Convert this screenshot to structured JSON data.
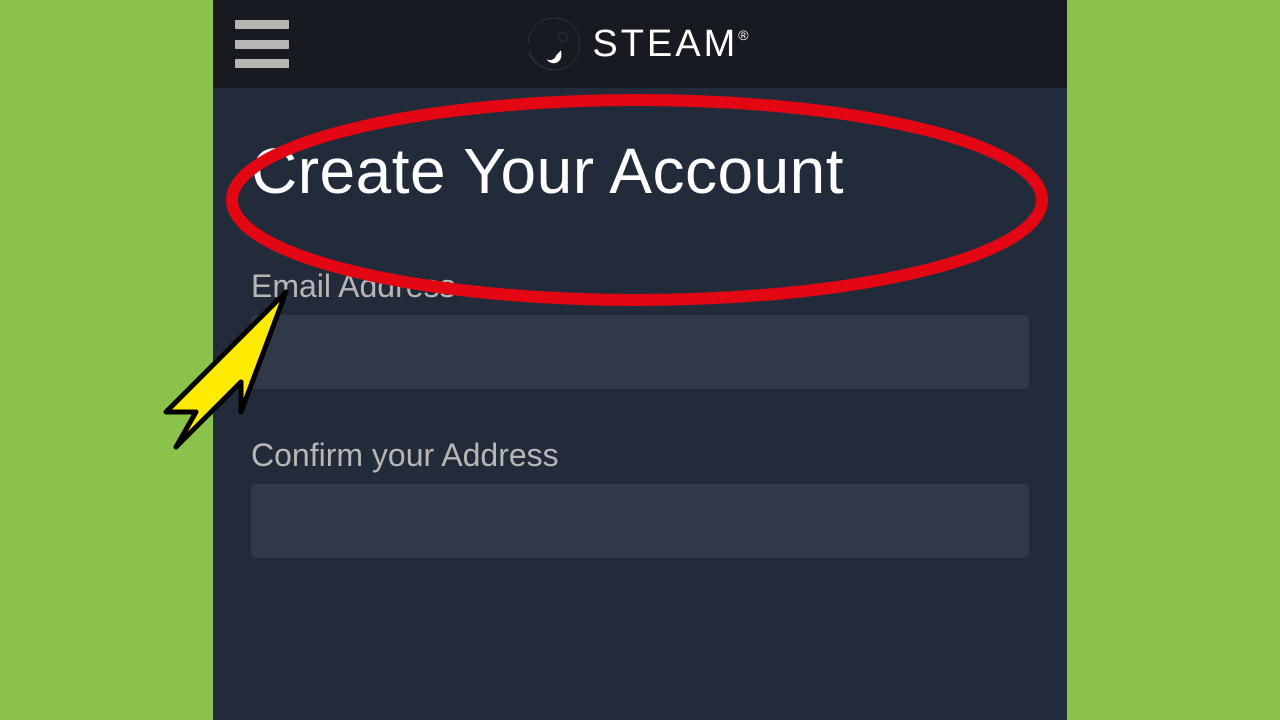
{
  "header": {
    "brand_text": "STEAM",
    "brand_trademark": "®"
  },
  "page": {
    "title": "Create Your Account"
  },
  "form": {
    "email_label": "Email Address",
    "email_value": "",
    "confirm_label": "Confirm your Address",
    "confirm_value": ""
  },
  "colors": {
    "background_outer": "#8BC34A",
    "header_bg": "#171a21",
    "content_bg": "#212b3a",
    "input_bg": "#30394a",
    "text_light": "#ffffff",
    "text_muted": "#b8b6b4",
    "annotation_red": "#E30613",
    "annotation_yellow": "#FFEB00"
  }
}
